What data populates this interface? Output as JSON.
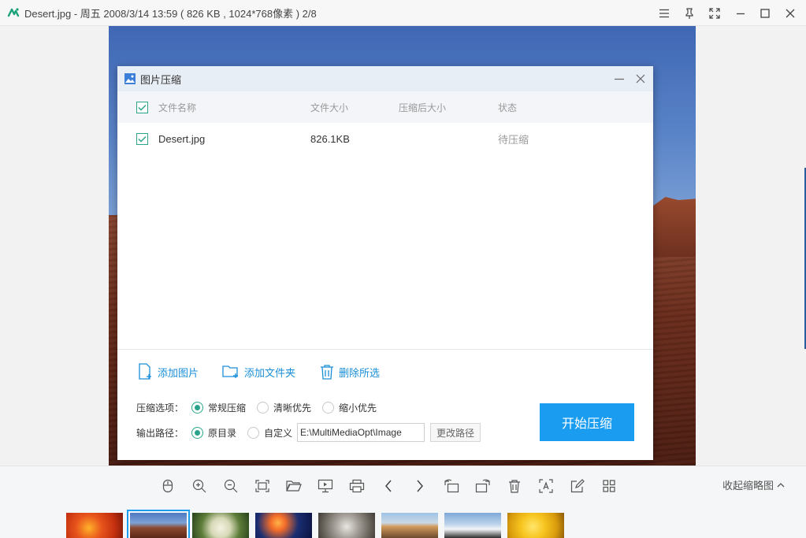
{
  "window": {
    "title": "Desert.jpg - 周五 2008/3/14 13:59 ( 826 KB , 1024*768像素 ) 2/8",
    "controls": [
      "menu-icon",
      "pin-icon",
      "fullscreen-icon",
      "minimize-icon",
      "maximize-icon",
      "close-icon"
    ]
  },
  "dialog": {
    "title": "图片压缩",
    "columns": {
      "name": "文件名称",
      "size": "文件大小",
      "compressed_size": "压缩后大小",
      "status": "状态"
    },
    "rows": [
      {
        "checked": true,
        "name": "Desert.jpg",
        "size": "826.1KB",
        "compressed_size": "",
        "status": "待压缩"
      }
    ],
    "actions": {
      "add_image": "添加图片",
      "add_folder": "添加文件夹",
      "delete_selected": "删除所选"
    },
    "compress_options": {
      "label": "压缩选项：",
      "options": [
        "常规压缩",
        "清晰优先",
        "缩小优先"
      ],
      "selected": "常规压缩"
    },
    "output_path": {
      "label": "输出路径：",
      "options": [
        "原目录",
        "自定义"
      ],
      "selected": "原目录",
      "path_value": "E:\\MultiMediaOpt\\Image",
      "change_button": "更改路径"
    },
    "start_button": "开始压缩",
    "accent_color": "#1a9cf0",
    "check_color": "#2aa58a"
  },
  "toolbar": {
    "icons": [
      "mouse-icon",
      "zoom-in-icon",
      "zoom-out-icon",
      "fit-window-icon",
      "open-folder-icon",
      "slideshow-icon",
      "print-icon",
      "previous-icon",
      "next-icon",
      "rotate-left-icon",
      "rotate-right-icon",
      "delete-icon",
      "ocr-icon",
      "edit-icon",
      "grid-icon"
    ],
    "collapse_label": "收起缩略图"
  },
  "thumbnails": {
    "count": 8,
    "selected_index": 1
  }
}
